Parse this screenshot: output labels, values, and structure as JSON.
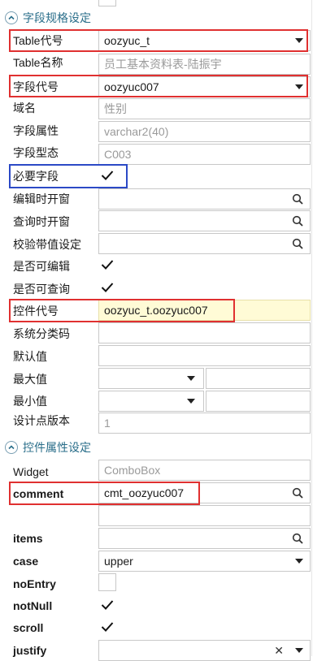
{
  "sections": {
    "spec": {
      "title": "字段规格设定"
    },
    "control": {
      "title": "控件属性设定"
    }
  },
  "fields": {
    "table_code": {
      "label": "Table代号",
      "value": "oozyuc_t"
    },
    "table_name": {
      "label": "Table名称",
      "value": "员工基本资料表-陆振宇"
    },
    "field_code": {
      "label": "字段代号",
      "value": "oozyuc007"
    },
    "domain": {
      "label": "域名",
      "value": "性别"
    },
    "field_attr": {
      "label": "字段属性",
      "value": "varchar2(40)"
    },
    "field_type": {
      "label": "字段型态",
      "value": "C003"
    },
    "required": {
      "label": "必要字段",
      "checked": true
    },
    "edit_open": {
      "label": "编辑时开窗",
      "value": ""
    },
    "query_open": {
      "label": "查询时开窗",
      "value": ""
    },
    "validate_default": {
      "label": "校验带值设定",
      "value": ""
    },
    "editable": {
      "label": "是否可编辑",
      "checked": true
    },
    "queryable": {
      "label": "是否可查询",
      "checked": true
    },
    "control_code": {
      "label": "控件代号",
      "value": "oozyuc_t.oozyuc007"
    },
    "sys_category": {
      "label": "系统分类码",
      "value": ""
    },
    "default_value": {
      "label": "默认值",
      "value": ""
    },
    "max_value": {
      "label": "最大值",
      "value": ""
    },
    "min_value": {
      "label": "最小值",
      "value": ""
    },
    "design_version": {
      "label": "设计点版本",
      "value": "1"
    }
  },
  "control_props": {
    "widget": {
      "label": "Widget",
      "value": "ComboBox"
    },
    "comment": {
      "label": "comment",
      "value": "cmt_oozyuc007"
    },
    "items": {
      "label": "items",
      "value": ""
    },
    "case": {
      "label": "case",
      "value": "upper"
    },
    "noentry": {
      "label": "noEntry",
      "checked": false
    },
    "notnull": {
      "label": "notNull",
      "checked": true
    },
    "scroll": {
      "label": "scroll",
      "checked": true
    },
    "justify": {
      "label": "justify",
      "value": ""
    }
  },
  "icons": {
    "dropdown": "chevron-down-icon",
    "search": "search-icon",
    "check": "check-icon",
    "clear": "close-icon",
    "collapse": "collapse-chevron-icon"
  },
  "colors": {
    "section_header": "#2a6e8a",
    "annotation_red": "#e03030",
    "annotation_blue": "#2b49c6",
    "highlight_field": "#fffbd6"
  }
}
